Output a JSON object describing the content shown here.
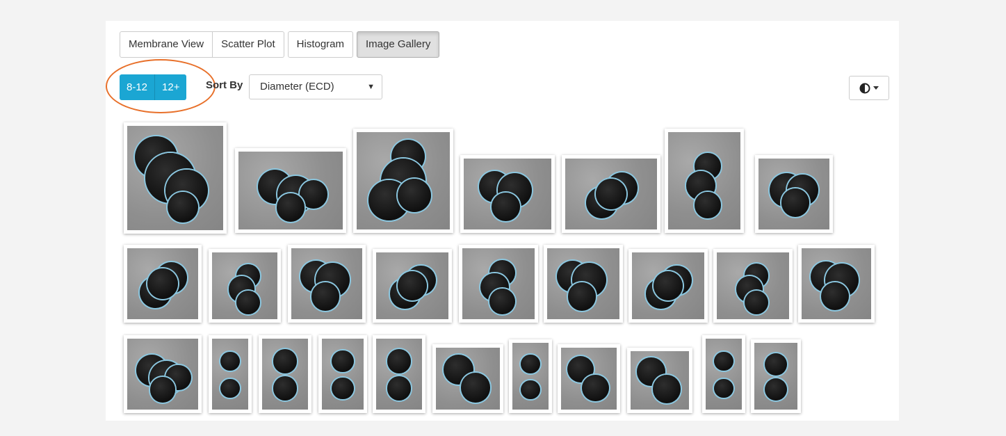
{
  "tabs": [
    {
      "label": "Membrane View"
    },
    {
      "label": "Scatter Plot"
    },
    {
      "label": "Histogram"
    },
    {
      "label": "Image Gallery"
    }
  ],
  "size_filter": [
    {
      "label": "8-12"
    },
    {
      "label": "12+"
    }
  ],
  "sort": {
    "label": "Sort By",
    "value": "Diameter (ECD)"
  },
  "contrast_icon": "contrast-icon",
  "colors": {
    "accent": "#1ba6d3",
    "highlight": "#e8702a",
    "outline": "#8bc7e0"
  }
}
